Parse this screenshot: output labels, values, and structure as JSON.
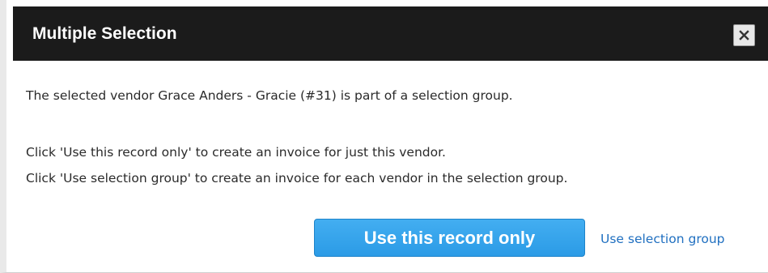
{
  "dialog": {
    "title": "Multiple Selection",
    "close_icon": "close-icon",
    "message_line1": "The selected vendor Grace Anders - Gracie (#31) is part of a selection group.",
    "message_line2": "Click 'Use this record only' to create an invoice for just this vendor.",
    "message_line3": "Click 'Use selection group' to create an invoice for each vendor in the selection group.",
    "primary_button_label": "Use this record only",
    "secondary_link_label": "Use selection group"
  },
  "colors": {
    "titlebar_bg": "#1b1b1b",
    "primary_button_bg": "#2b9be6",
    "link": "#1f6fc0"
  }
}
